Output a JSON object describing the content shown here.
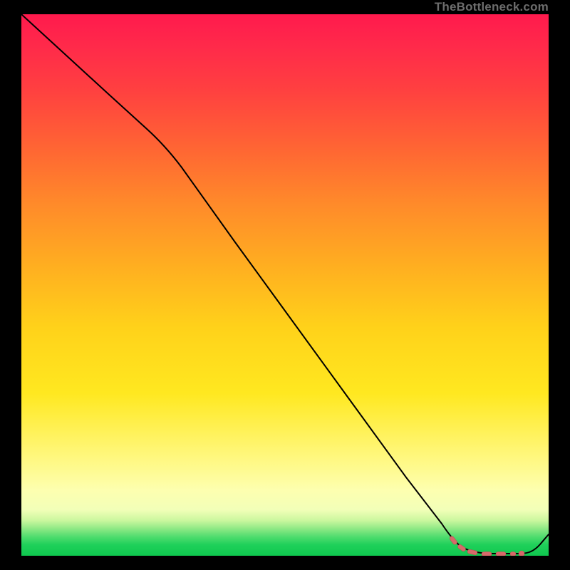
{
  "watermark": "TheBottleneck.com",
  "colors": {
    "page_bg": "#000000",
    "line": "#000000",
    "dash": "#d66a6a",
    "gradient_top": "#ff1a4d",
    "gradient_mid": "#ffe820",
    "gradient_bottom": "#0fc84f"
  },
  "chart_data": {
    "type": "line",
    "title": "",
    "xlabel": "",
    "ylabel": "",
    "xlim": [
      0,
      100
    ],
    "ylim": [
      0,
      100
    ],
    "grid": false,
    "legend": false,
    "series": [
      {
        "name": "curve",
        "x": [
          0,
          5,
          10,
          15,
          20,
          25,
          30,
          35,
          40,
          45,
          50,
          55,
          60,
          65,
          70,
          75,
          80,
          82,
          85,
          88,
          91,
          94,
          97,
          100
        ],
        "values": [
          100,
          96,
          92,
          88,
          84,
          80,
          75,
          68,
          60,
          52,
          44,
          36,
          28,
          20,
          13,
          7,
          3,
          1.5,
          0.6,
          0.4,
          0.3,
          0.3,
          1.0,
          3.0
        ]
      }
    ],
    "annotations": [
      {
        "name": "dashed-highlight",
        "style": "dashed",
        "color": "#d66a6a",
        "x": [
          80,
          82,
          84,
          86,
          88,
          90,
          92,
          94
        ],
        "values": [
          2.8,
          1.6,
          1.0,
          0.7,
          0.5,
          0.4,
          0.35,
          0.3
        ]
      },
      {
        "name": "end-dot",
        "style": "dot",
        "color": "#d66a6a",
        "x": 94,
        "value": 0.3
      }
    ]
  }
}
